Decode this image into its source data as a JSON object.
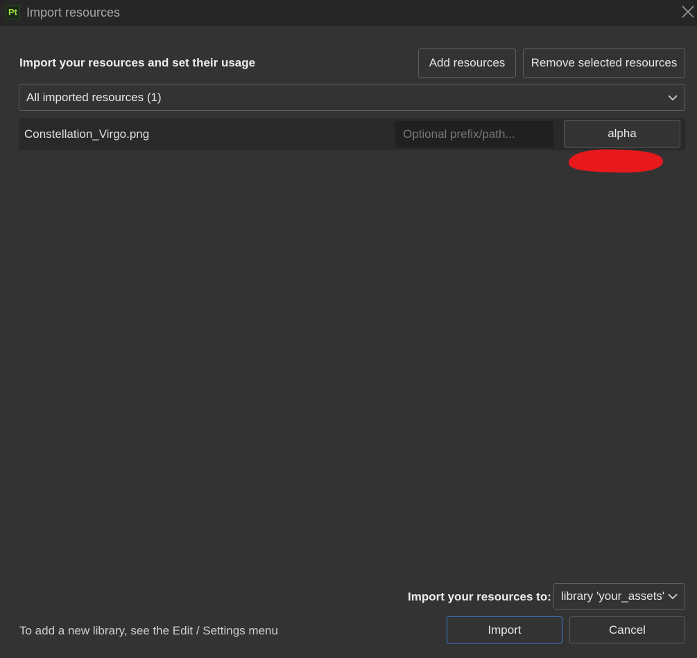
{
  "window": {
    "app_icon_label": "Pt",
    "title": "Import resources",
    "close_icon": "close-icon"
  },
  "header": {
    "heading": "Import your resources and set their usage",
    "add_button": "Add resources",
    "remove_button": "Remove selected resources"
  },
  "filter": {
    "selected": "All imported resources (1)"
  },
  "resources": [
    {
      "name": "Constellation_Virgo.png",
      "prefix_placeholder": "Optional prefix/path...",
      "prefix_value": "",
      "usage": "alpha"
    }
  ],
  "footer": {
    "target_label": "Import your resources to:",
    "target_selected": "library 'your_assets'",
    "hint": "To add a new library, see the Edit / Settings menu",
    "import_button": "Import",
    "cancel_button": "Cancel"
  },
  "colors": {
    "background": "#333333",
    "titlebar": "#262626",
    "row": "#292929",
    "accent_focus": "#3f7fd6",
    "redaction": "#e8191c",
    "app_icon_text": "#a7e03d"
  }
}
